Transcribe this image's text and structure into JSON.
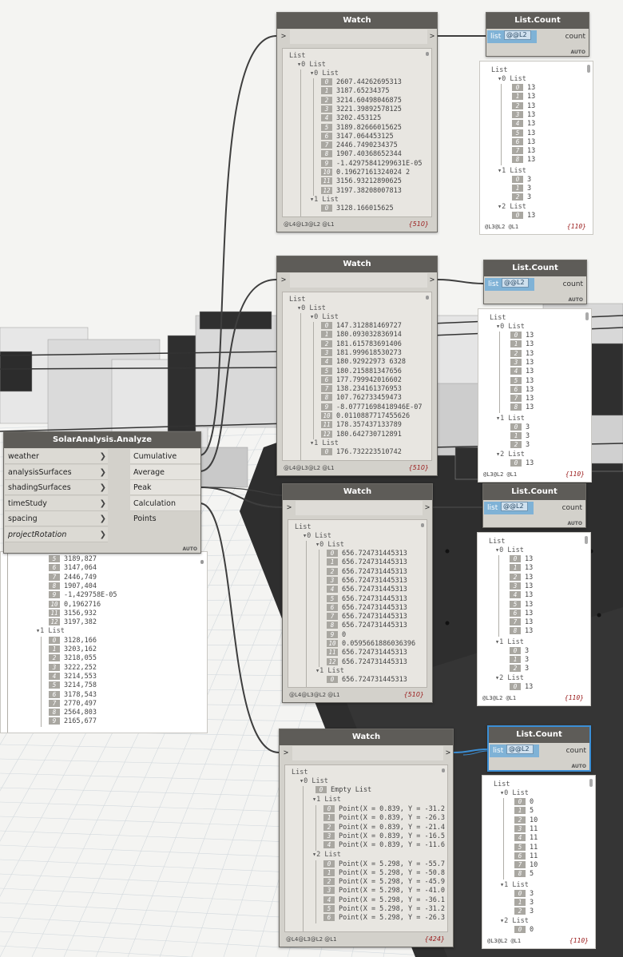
{
  "solar_node": {
    "title": "SolarAnalysis.Analyze",
    "inputs": [
      "weather",
      "analysisSurfaces",
      "shadingSurfaces",
      "timeStudy",
      "spacing",
      "projectRotation"
    ],
    "outputs": [
      "Cumulative",
      "Average",
      "Peak",
      "Calculation Points"
    ],
    "mode": "AUTO"
  },
  "solar_preview": {
    "top_cut_value": "3189,827",
    "list0_tail": [
      {
        "i": "6",
        "v": "3147,064"
      },
      {
        "i": "7",
        "v": "2446,749"
      },
      {
        "i": "8",
        "v": "1907,404"
      },
      {
        "i": "9",
        "v": "-1,429758E-05"
      },
      {
        "i": "10",
        "v": "0,1962716"
      },
      {
        "i": "11",
        "v": "3156,932"
      },
      {
        "i": "12",
        "v": "3197,382"
      }
    ],
    "list1_label": "1 List",
    "list1_items": [
      {
        "i": "0",
        "v": "3128,166"
      },
      {
        "i": "1",
        "v": "3203,162"
      },
      {
        "i": "2",
        "v": "3218,055"
      },
      {
        "i": "3",
        "v": "3222,252"
      },
      {
        "i": "4",
        "v": "3214,553"
      },
      {
        "i": "5",
        "v": "3214,758"
      },
      {
        "i": "6",
        "v": "3178,543"
      },
      {
        "i": "7",
        "v": "2770,497"
      },
      {
        "i": "8",
        "v": "2564,803"
      },
      {
        "i": "9",
        "v": "2165,677"
      }
    ]
  },
  "watch_nodes": [
    {
      "title": "Watch",
      "in_port": ">",
      "out_port": ">",
      "root": "List",
      "lvl1": "0 List",
      "lvl2": "0 List",
      "items": [
        {
          "i": "0",
          "v": "2607.44262695313"
        },
        {
          "i": "1",
          "v": "3187.65234375"
        },
        {
          "i": "2",
          "v": "3214.60498046875"
        },
        {
          "i": "3",
          "v": "3221.39892578125"
        },
        {
          "i": "4",
          "v": "3202.453125"
        },
        {
          "i": "5",
          "v": "3189.82666015625"
        },
        {
          "i": "6",
          "v": "3147.064453125"
        },
        {
          "i": "7",
          "v": "2446.7490234375"
        },
        {
          "i": "8",
          "v": "1907.40368652344"
        },
        {
          "i": "9",
          "v": "-1.42975841299631E-05"
        },
        {
          "i": "10",
          "v": "0.19627161324024 2"
        },
        {
          "i": "11",
          "v": "3156.93212890625"
        },
        {
          "i": "12",
          "v": "3197.38208007813"
        }
      ],
      "next_list": "1 List",
      "next_item": {
        "i": "0",
        "v": "3128.166015625"
      },
      "levels": "@L4@L3@L2 @L1",
      "count": "{510}"
    },
    {
      "title": "Watch",
      "in_port": ">",
      "out_port": ">",
      "root": "List",
      "lvl1": "0 List",
      "lvl2": "0 List",
      "items": [
        {
          "i": "0",
          "v": "147.312881469727"
        },
        {
          "i": "1",
          "v": "180.093032836914"
        },
        {
          "i": "2",
          "v": "181.615783691406"
        },
        {
          "i": "3",
          "v": "181.999618530273"
        },
        {
          "i": "4",
          "v": "180.92922973 6328"
        },
        {
          "i": "5",
          "v": "180.215881347656"
        },
        {
          "i": "6",
          "v": "177.799942016602"
        },
        {
          "i": "7",
          "v": "138.234161376953"
        },
        {
          "i": "8",
          "v": "107.762733459473"
        },
        {
          "i": "9",
          "v": "-8.07771698418946E-07"
        },
        {
          "i": "10",
          "v": "0.0110887717455626"
        },
        {
          "i": "11",
          "v": "178.357437133789"
        },
        {
          "i": "12",
          "v": "180.642730712891"
        }
      ],
      "next_list": "1 List",
      "next_item": {
        "i": "0",
        "v": "176.732223510742"
      },
      "levels": "@L4@L3@L2 @L1",
      "count": "{510}"
    },
    {
      "title": "Watch",
      "in_port": ">",
      "out_port": ">",
      "root": "List",
      "lvl1": "0 List",
      "lvl2": "0 List",
      "items": [
        {
          "i": "0",
          "v": "656.724731445313"
        },
        {
          "i": "1",
          "v": "656.724731445313"
        },
        {
          "i": "2",
          "v": "656.724731445313"
        },
        {
          "i": "3",
          "v": "656.724731445313"
        },
        {
          "i": "4",
          "v": "656.724731445313"
        },
        {
          "i": "5",
          "v": "656.724731445313"
        },
        {
          "i": "6",
          "v": "656.724731445313"
        },
        {
          "i": "7",
          "v": "656.724731445313"
        },
        {
          "i": "8",
          "v": "656.724731445313"
        },
        {
          "i": "9",
          "v": "0"
        },
        {
          "i": "10",
          "v": "0.0595661886036396"
        },
        {
          "i": "11",
          "v": "656.724731445313"
        },
        {
          "i": "12",
          "v": "656.724731445313"
        }
      ],
      "next_list": "1 List",
      "next_item": {
        "i": "0",
        "v": "656.724731445313"
      },
      "levels": "@L4@L3@L2 @L1",
      "count": "{510}"
    },
    {
      "title": "Watch",
      "in_port": ">",
      "out_port": ">",
      "root": "List",
      "lvl1": "0 List",
      "empty": {
        "i": "0",
        "v": "Empty List"
      },
      "list1": "1 List",
      "list1_items": [
        {
          "i": "0",
          "v": "Point(X = 0.839, Y = -31.2"
        },
        {
          "i": "1",
          "v": "Point(X = 0.839, Y = -26.3"
        },
        {
          "i": "2",
          "v": "Point(X = 0.839, Y = -21.4"
        },
        {
          "i": "3",
          "v": "Point(X = 0.839, Y = -16.5"
        },
        {
          "i": "4",
          "v": "Point(X = 0.839, Y = -11.6"
        }
      ],
      "list2": "2 List",
      "list2_items": [
        {
          "i": "0",
          "v": "Point(X = 5.298, Y = -55.7"
        },
        {
          "i": "1",
          "v": "Point(X = 5.298, Y = -50.8"
        },
        {
          "i": "2",
          "v": "Point(X = 5.298, Y = -45.9"
        },
        {
          "i": "3",
          "v": "Point(X = 5.298, Y = -41.0"
        },
        {
          "i": "4",
          "v": "Point(X = 5.298, Y = -36.1"
        },
        {
          "i": "5",
          "v": "Point(X = 5.298, Y = -31.2"
        },
        {
          "i": "6",
          "v": "Point(X = 5.298, Y = -26.3"
        }
      ],
      "levels": "@L4@L3@L2 @L1",
      "count": "{424}"
    }
  ],
  "count_nodes": [
    {
      "title": "List.Count",
      "input": "list",
      "lacing": "@@L2",
      "output": "count",
      "mode": "AUTO",
      "root": "List",
      "lvl1": "0 List",
      "items": [
        {
          "i": "0",
          "v": "13"
        },
        {
          "i": "1",
          "v": "13"
        },
        {
          "i": "2",
          "v": "13"
        },
        {
          "i": "3",
          "v": "13"
        },
        {
          "i": "4",
          "v": "13"
        },
        {
          "i": "5",
          "v": "13"
        },
        {
          "i": "6",
          "v": "13"
        },
        {
          "i": "7",
          "v": "13"
        },
        {
          "i": "8",
          "v": "13"
        }
      ],
      "list1": "1 List",
      "list1_items": [
        {
          "i": "0",
          "v": "3"
        },
        {
          "i": "1",
          "v": "3"
        },
        {
          "i": "2",
          "v": "3"
        }
      ],
      "list2": "2 List",
      "list2_items": [
        {
          "i": "0",
          "v": "13"
        }
      ],
      "levels": "@L3@L2 @L1",
      "count": "{110}"
    },
    {
      "title": "List.Count",
      "input": "list",
      "lacing": "@@L2",
      "output": "count",
      "mode": "AUTO",
      "root": "List",
      "lvl1": "0 List",
      "items": [
        {
          "i": "0",
          "v": "13"
        },
        {
          "i": "1",
          "v": "13"
        },
        {
          "i": "2",
          "v": "13"
        },
        {
          "i": "3",
          "v": "13"
        },
        {
          "i": "4",
          "v": "13"
        },
        {
          "i": "5",
          "v": "13"
        },
        {
          "i": "6",
          "v": "13"
        },
        {
          "i": "7",
          "v": "13"
        },
        {
          "i": "8",
          "v": "13"
        }
      ],
      "list1": "1 List",
      "list1_items": [
        {
          "i": "0",
          "v": "3"
        },
        {
          "i": "1",
          "v": "3"
        },
        {
          "i": "2",
          "v": "3"
        }
      ],
      "list2": "2 List",
      "list2_items": [
        {
          "i": "0",
          "v": "13"
        }
      ],
      "levels": "@L3@L2 @L1",
      "count": "{110}"
    },
    {
      "title": "List.Count",
      "input": "list",
      "lacing": "@@L2",
      "output": "count",
      "mode": "AUTO",
      "root": "List",
      "lvl1": "0 List",
      "items": [
        {
          "i": "0",
          "v": "13"
        },
        {
          "i": "1",
          "v": "13"
        },
        {
          "i": "2",
          "v": "13"
        },
        {
          "i": "3",
          "v": "13"
        },
        {
          "i": "4",
          "v": "13"
        },
        {
          "i": "5",
          "v": "13"
        },
        {
          "i": "6",
          "v": "13"
        },
        {
          "i": "7",
          "v": "13"
        },
        {
          "i": "8",
          "v": "13"
        }
      ],
      "list1": "1 List",
      "list1_items": [
        {
          "i": "0",
          "v": "3"
        },
        {
          "i": "1",
          "v": "3"
        },
        {
          "i": "2",
          "v": "3"
        }
      ],
      "list2": "2 List",
      "list2_items": [
        {
          "i": "0",
          "v": "13"
        }
      ],
      "levels": "@L3@L2 @L1",
      "count": "{110}"
    },
    {
      "title": "List.Count",
      "input": "list",
      "lacing": "@@L2",
      "output": "count",
      "mode": "AUTO",
      "root": "List",
      "lvl1": "0 List",
      "items": [
        {
          "i": "0",
          "v": "0"
        },
        {
          "i": "1",
          "v": "5"
        },
        {
          "i": "2",
          "v": "10"
        },
        {
          "i": "3",
          "v": "11"
        },
        {
          "i": "4",
          "v": "11"
        },
        {
          "i": "5",
          "v": "11"
        },
        {
          "i": "6",
          "v": "11"
        },
        {
          "i": "7",
          "v": "10"
        },
        {
          "i": "8",
          "v": "5"
        }
      ],
      "list1": "1 List",
      "list1_items": [
        {
          "i": "0",
          "v": "3"
        },
        {
          "i": "1",
          "v": "3"
        },
        {
          "i": "2",
          "v": "3"
        }
      ],
      "list2": "2 List",
      "list2_items": [
        {
          "i": "0",
          "v": "0"
        }
      ],
      "levels": "@L3@L2 @L1",
      "count": "{110}"
    }
  ],
  "colors": {
    "node_header": "#5e5c58",
    "node_body": "#d3d1cb",
    "selected_border": "#3b8fd6",
    "wire": "#3e3e3e",
    "selected_wire": "#3b8fd6",
    "count_text": "#9a1b1b"
  }
}
